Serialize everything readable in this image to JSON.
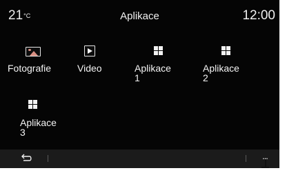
{
  "status": {
    "temperature": "21",
    "temperature_unit": "°C",
    "title": "Aplikace",
    "time": "12:00"
  },
  "apps": [
    {
      "label": "Fotografie",
      "icon": "photo-icon"
    },
    {
      "label": "Video",
      "icon": "video-icon"
    },
    {
      "label": "Aplikace\n1",
      "icon": "grid-icon"
    },
    {
      "label": "Aplikace\n2",
      "icon": "grid-icon"
    },
    {
      "label": "Aplikace\n3",
      "icon": "grid-icon"
    }
  ],
  "bottom_bar": {
    "back_icon": "back-arrow-icon",
    "more_label": "...",
    "more_icon": "more-options-icon"
  },
  "colors": {
    "background": "#050505",
    "bar": "#1b1b1b",
    "text": "#f2f2f2",
    "photo_accent": "#d99083"
  }
}
